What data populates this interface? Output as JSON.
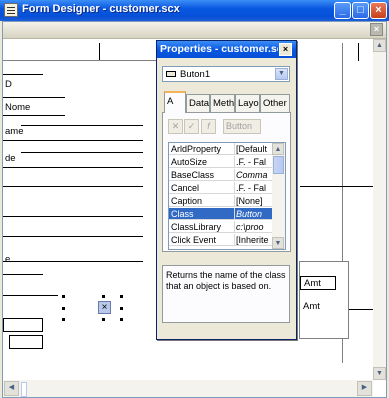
{
  "window": {
    "title": "Form Designer - customer.scx"
  },
  "canvas": {
    "labels": [
      "D",
      "Nome",
      "ame",
      "de",
      "e"
    ],
    "right_labels": [
      "Amt",
      "Amt"
    ],
    "selected_button_glyph": "×"
  },
  "properties": {
    "title": "Properties - customer.scx",
    "object": "Buton1",
    "tabs": [
      "A",
      "Data",
      "Methods",
      "Layout",
      "Other"
    ],
    "tabs_display": [
      "A",
      "Data",
      "Meth",
      "Layo",
      "Other"
    ],
    "active_tab": 0,
    "toolbar": {
      "value_placeholder": "Button"
    },
    "rows": [
      {
        "name": "ArldProperty",
        "value": "[Default"
      },
      {
        "name": "AutoSize",
        "value": ".F. - Fal"
      },
      {
        "name": "BaseClass",
        "value": "Comma",
        "italic": true
      },
      {
        "name": "Cancel",
        "value": ".F. - Fal"
      },
      {
        "name": "Caption",
        "value": "[None]"
      },
      {
        "name": "Class",
        "value": "Button",
        "selected": true
      },
      {
        "name": "ClassLibrary",
        "value": "c:\\proo",
        "italic": true
      },
      {
        "name": "Click Event",
        "value": "[Inherite"
      }
    ],
    "description": "Returns the name of the class that an object is based on."
  },
  "colors": {
    "title_blue": "#0a58e0",
    "selection": "#316ac5"
  }
}
